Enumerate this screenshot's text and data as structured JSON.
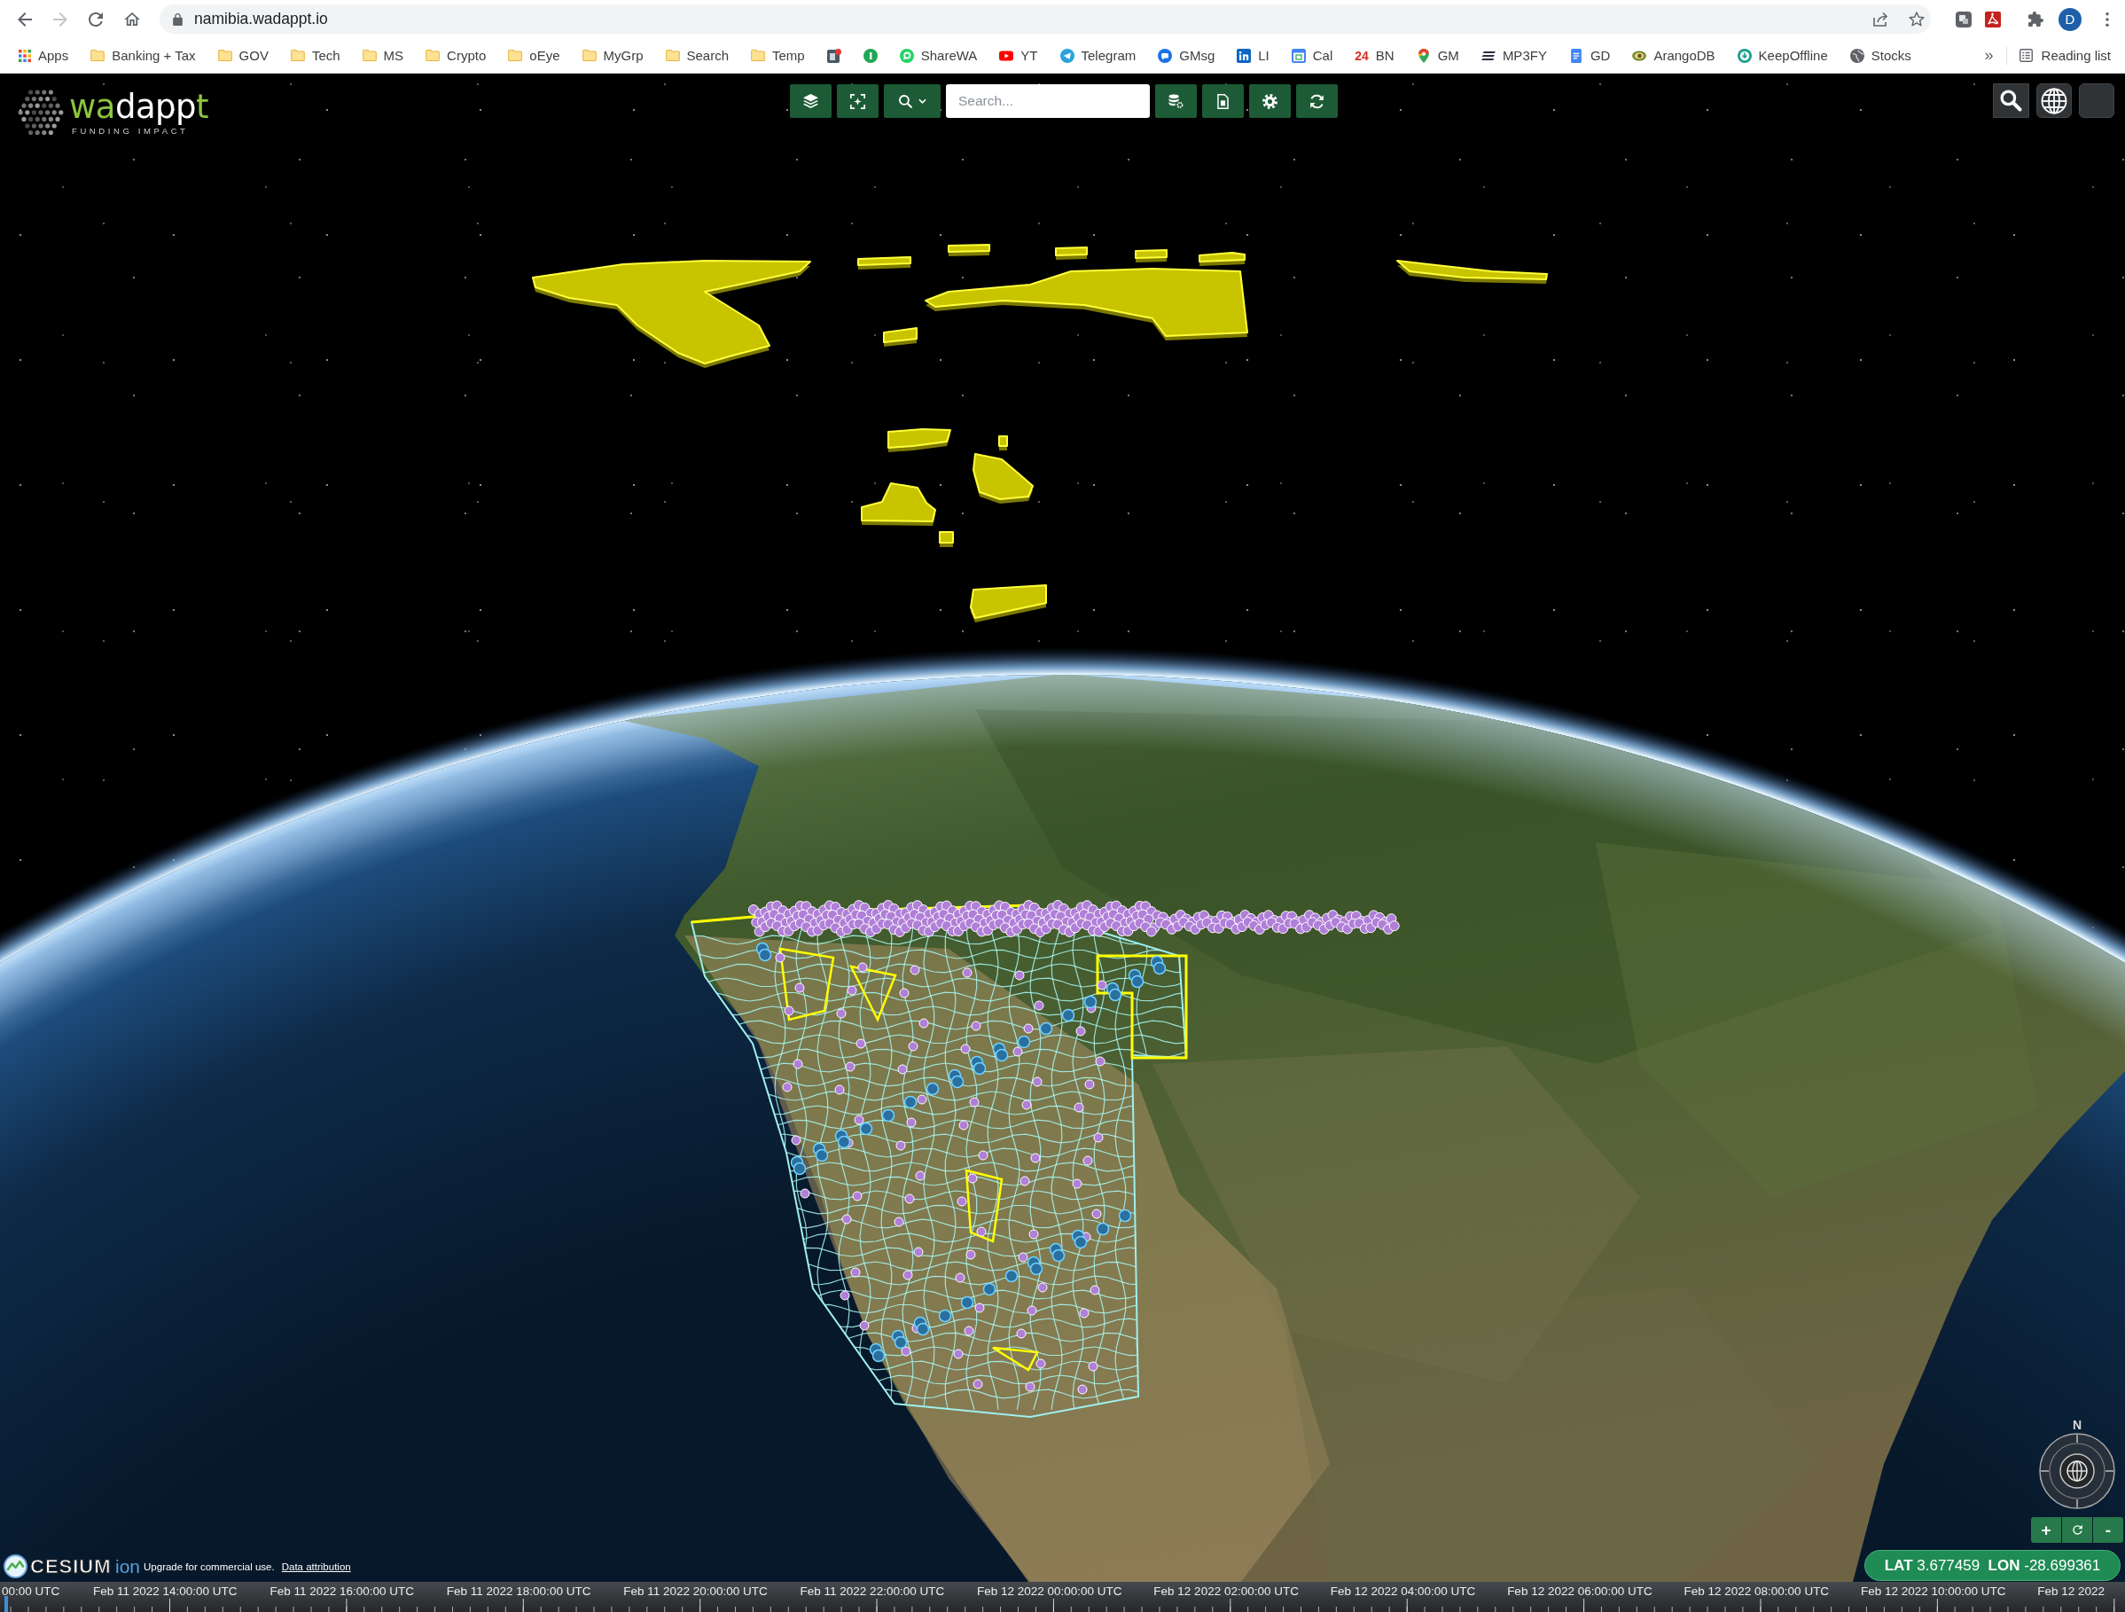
{
  "browser": {
    "url": "namibia.wadappt.io",
    "back_disabled": false,
    "forward_disabled": true,
    "profile_initial": "D"
  },
  "bookmarks": [
    {
      "label": "Apps",
      "kind": "apps"
    },
    {
      "label": "Banking + Tax",
      "kind": "folder"
    },
    {
      "label": "GOV",
      "kind": "folder"
    },
    {
      "label": "Tech",
      "kind": "folder"
    },
    {
      "label": "MS",
      "kind": "folder"
    },
    {
      "label": "Crypto",
      "kind": "folder"
    },
    {
      "label": "oEye",
      "kind": "folder"
    },
    {
      "label": "MyGrp",
      "kind": "folder"
    },
    {
      "label": "Search",
      "kind": "folder"
    },
    {
      "label": "Temp",
      "kind": "folder"
    },
    {
      "kind": "site"
    },
    {
      "kind": "site"
    },
    {
      "label": "ShareWA",
      "kind": "site"
    },
    {
      "label": "YT",
      "kind": "site"
    },
    {
      "label": "Telegram",
      "kind": "site"
    },
    {
      "label": "GMsg",
      "kind": "site"
    },
    {
      "label": "LI",
      "kind": "site"
    },
    {
      "label": "Cal",
      "kind": "site"
    },
    {
      "label": "BN",
      "kind": "site",
      "icon_text": "24"
    },
    {
      "label": "GM",
      "kind": "site"
    },
    {
      "label": "MP3FY",
      "kind": "site"
    },
    {
      "label": "GD",
      "kind": "site"
    },
    {
      "label": "ArangoDB",
      "kind": "site"
    },
    {
      "label": "KeepOffline",
      "kind": "site"
    },
    {
      "label": "Stocks",
      "kind": "site"
    }
  ],
  "bookmarks_overflow": "»",
  "reading_list": "Reading list",
  "app": {
    "logo": {
      "wordmark": [
        {
          "text": "wa",
          "accent": true
        },
        {
          "text": "dapp",
          "accent": false
        },
        {
          "text": "t",
          "accent": true
        }
      ],
      "tagline": "FUNDING IMPACT"
    },
    "search": {
      "placeholder": "Search..."
    }
  },
  "credits": {
    "logo": "CESIUM",
    "logo_suffix": "ion",
    "notice": "Upgrade for commercial use.",
    "link": "Data attribution"
  },
  "map_controls": {
    "north": "N",
    "zoom_in": "+",
    "zoom_out": "-",
    "coordinates": "**LAT** 3.677459  **LON** -28.699361"
  },
  "timeline": {
    "labels": [
      "00:00 UTC",
      "Feb 11 2022 14:00:00 UTC",
      "Feb 11 2022 16:00:00 UTC",
      "Feb 11 2022 18:00:00 UTC",
      "Feb 11 2022 20:00:00 UTC",
      "Feb 11 2022 22:00:00 UTC",
      "Feb 12 2022 00:00:00 UTC",
      "Feb 12 2022 02:00:00 UTC",
      "Feb 12 2022 04:00:00 UTC",
      "Feb 12 2022 06:00:00 UTC",
      "Feb 12 2022 08:00:00 UTC",
      "Feb 12 2022 10:00:00 UTC",
      "Feb 12 2022"
    ]
  }
}
